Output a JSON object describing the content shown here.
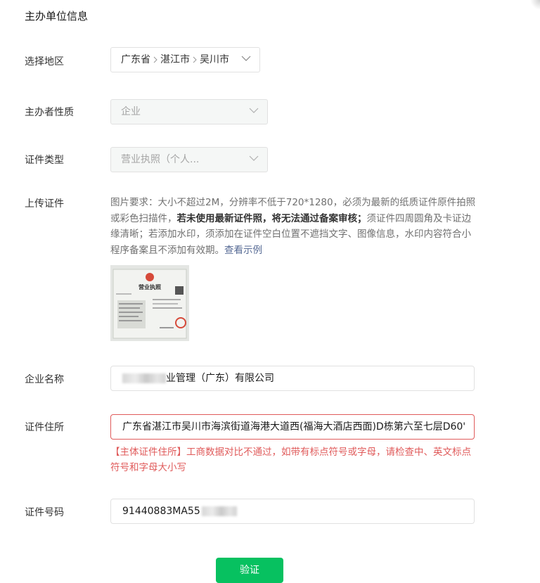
{
  "section_title": "主办单位信息",
  "region": {
    "label": "选择地区",
    "province": "广东省",
    "city": "湛江市",
    "district": "吴川市"
  },
  "organizer_type": {
    "label": "主办者性质",
    "value": "企业"
  },
  "cert_type": {
    "label": "证件类型",
    "value": "营业执照（个人..."
  },
  "upload": {
    "label": "上传证件",
    "help_part1": "图片要求：大小不超过2M，分辨率不低于720*1280，必须为最新的纸质证件原件拍照或彩色扫描件，",
    "help_bold": "若未使用最新证件照，将无法通过备案审核；",
    "help_part2": "须证件四周圆角及卡证边缘清晰；若添加水印，须添加在证件空白位置不遮挡文字、图像信息，水印内容符合小程序备案且不添加有效期。",
    "view_example": "查看示例",
    "thumb_title": "营业执照"
  },
  "company_name": {
    "label": "企业名称",
    "value_visible": "业管理（广东）有限公司"
  },
  "cert_address": {
    "label": "证件住所",
    "value": "广东省湛江市吴川市海滨街道海港大道西(福海大酒店西面)D栋第六至七层D60'",
    "error": "【主体证件住所】工商数据对比不通过，如带有标点符号或字母，请检查中、英文标点符号和字母大小写"
  },
  "cert_number": {
    "label": "证件号码",
    "value_visible": "91440883MA55"
  },
  "verify_button": "验证",
  "colors": {
    "primary_green": "#07c160",
    "error_red": "#e05b5b",
    "link_blue": "#576b95"
  }
}
